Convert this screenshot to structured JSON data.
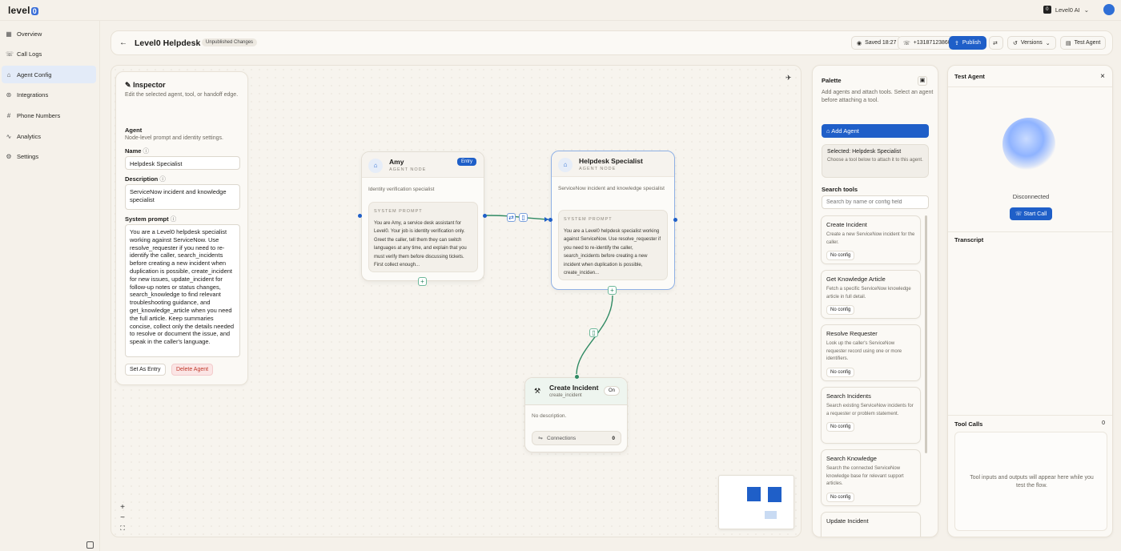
{
  "app": {
    "logo_text": "level",
    "logo_badge": "0",
    "org_icon": "0",
    "org_name": "Level0 AI",
    "org_caret": "⌄"
  },
  "sidebar": {
    "items": [
      {
        "label": "Overview",
        "icon": "grid-icon"
      },
      {
        "label": "Call Logs",
        "icon": "phone-icon"
      },
      {
        "label": "Agent Config",
        "icon": "robot-icon",
        "active": true
      },
      {
        "label": "Integrations",
        "icon": "plug-icon"
      },
      {
        "label": "Phone Numbers",
        "icon": "hash-icon"
      },
      {
        "label": "Analytics",
        "icon": "chart-icon"
      },
      {
        "label": "Settings",
        "icon": "gear-icon"
      }
    ]
  },
  "header": {
    "title": "Level0 Helpdesk",
    "status_chip": "Unpublished Changes",
    "saved": "Saved 18:27",
    "phone": "+13187123860",
    "publish": "Publish",
    "versions": "Versions",
    "test_agent": "Test Agent"
  },
  "inspector": {
    "title": "Inspector",
    "subtitle": "Edit the selected agent, tool, or handoff edge.",
    "section": "Agent",
    "section_sub": "Node-level prompt and identity settings.",
    "name_label": "Name",
    "name_value": "Helpdesk Specialist",
    "desc_label": "Description",
    "desc_value": "ServiceNow incident and knowledge specialist",
    "prompt_label": "System prompt",
    "prompt_value": "You are a Level0 helpdesk specialist working against ServiceNow. Use resolve_requester if you need to re-identify the caller, search_incidents before creating a new incident when duplication is possible, create_incident for new issues, update_incident for follow-up notes or status changes, search_knowledge to find relevant troubleshooting guidance, and get_knowledge_article when you need the full article. Keep summaries concise, collect only the details needed to resolve or document the issue, and speak in the caller's language.",
    "set_entry": "Set As Entry",
    "delete": "Delete Agent"
  },
  "nodes": {
    "amy": {
      "title": "Amy",
      "kind": "AGENT NODE",
      "badge": "Entry",
      "desc": "Identity verification specialist",
      "prompt_caption": "SYSTEM PROMPT",
      "prompt": "You are Amy, a service desk assistant for Level0. Your job is identity verification only. Greet the caller, tell them they can switch languages at any time, and explain that you must verify them before discussing tickets. First collect enough..."
    },
    "specialist": {
      "title": "Helpdesk Specialist",
      "kind": "AGENT NODE",
      "desc": "ServiceNow incident and knowledge specialist",
      "prompt_caption": "SYSTEM PROMPT",
      "prompt": "You are a Level0 helpdesk specialist working against ServiceNow. Use resolve_requester if you need to re-identify the caller, search_incidents before creating a new incident when duplication is possible, create_incidən..."
    },
    "tool": {
      "title": "Create Incident",
      "slug": "create_incident",
      "toggle": "On",
      "desc": "No description.",
      "connections_label": "Connections",
      "connections_count": "0"
    }
  },
  "palette": {
    "title": "Palette",
    "subtitle": "Add agents and attach tools. Select an agent before attaching a tool.",
    "add_agent": "Add Agent",
    "selected_title": "Selected: Helpdesk Specialist",
    "selected_sub": "Choose a tool below to attach it to this agent.",
    "search_label": "Search tools",
    "search_placeholder": "Search by name or config field",
    "tools": [
      {
        "name": "Create Incident",
        "desc": "Create a new ServiceNow incident for the caller.",
        "chip": "No config"
      },
      {
        "name": "Get Knowledge Article",
        "desc": "Fetch a specific ServiceNow knowledge article in full detail.",
        "chip": "No config"
      },
      {
        "name": "Resolve Requester",
        "desc": "Look up the caller's ServiceNow requester record using one or more identifiers.",
        "chip": "No config"
      },
      {
        "name": "Search Incidents",
        "desc": "Search existing ServiceNow incidents for a requester or problem statement.",
        "chip": "No config"
      },
      {
        "name": "Search Knowledge",
        "desc": "Search the connected ServiceNow knowledge base for relevant support articles.",
        "chip": "No config"
      },
      {
        "name": "Update Incident",
        "desc": "",
        "chip": ""
      }
    ]
  },
  "test_agent": {
    "title": "Test Agent",
    "status": "Disconnected",
    "start_call": "Start Call",
    "transcript": "Transcript",
    "tool_calls": "Tool Calls",
    "tool_calls_count": "0",
    "tool_calls_empty": "Tool inputs and outputs will appear here while you test the flow."
  },
  "colors": {
    "accent": "#1f5fc8",
    "edge": "#2f8a63",
    "background": "#f5f1ea"
  }
}
